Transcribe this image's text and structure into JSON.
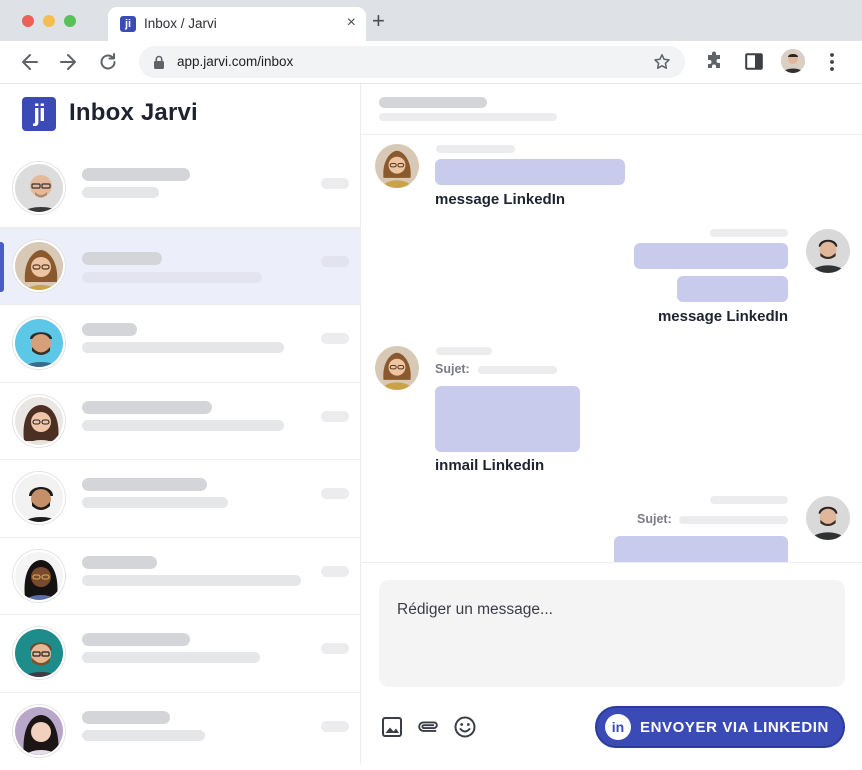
{
  "browser": {
    "tab_title": "Inbox / Jarvi",
    "tab_favicon": "ji",
    "tab_close": "×",
    "new_tab": "+",
    "url": "app.jarvi.com/inbox"
  },
  "app": {
    "logo_text": "ji",
    "title": "Inbox Jarvi"
  },
  "conversations": [
    {
      "avatar": "bald-man-glasses",
      "active": false
    },
    {
      "avatar": "woman-glasses",
      "active": true
    },
    {
      "avatar": "man-beard",
      "active": false
    },
    {
      "avatar": "woman-curly-hair",
      "active": false
    },
    {
      "avatar": "man-dark-hair",
      "active": false
    },
    {
      "avatar": "woman-black-hair",
      "active": false
    },
    {
      "avatar": "man-glasses-beard",
      "active": false
    },
    {
      "avatar": "woman-long-hair",
      "active": false
    }
  ],
  "chat": {
    "messages": [
      {
        "direction": "incoming",
        "channel": "message LinkedIn"
      },
      {
        "direction": "outgoing",
        "channel": "message LinkedIn"
      },
      {
        "direction": "incoming",
        "subject_label": "Sujet:",
        "channel": "inmail Linkedin"
      },
      {
        "direction": "outgoing",
        "subject_label": "Sujet:"
      }
    ]
  },
  "composer": {
    "placeholder": "Rédiger un message...",
    "send_label": "ENVOYER VIA LINKEDIN",
    "send_icon": "in"
  },
  "colors": {
    "brand": "#3b4bb5",
    "bubble": "#c9cbec",
    "active_row": "#eceef9"
  }
}
